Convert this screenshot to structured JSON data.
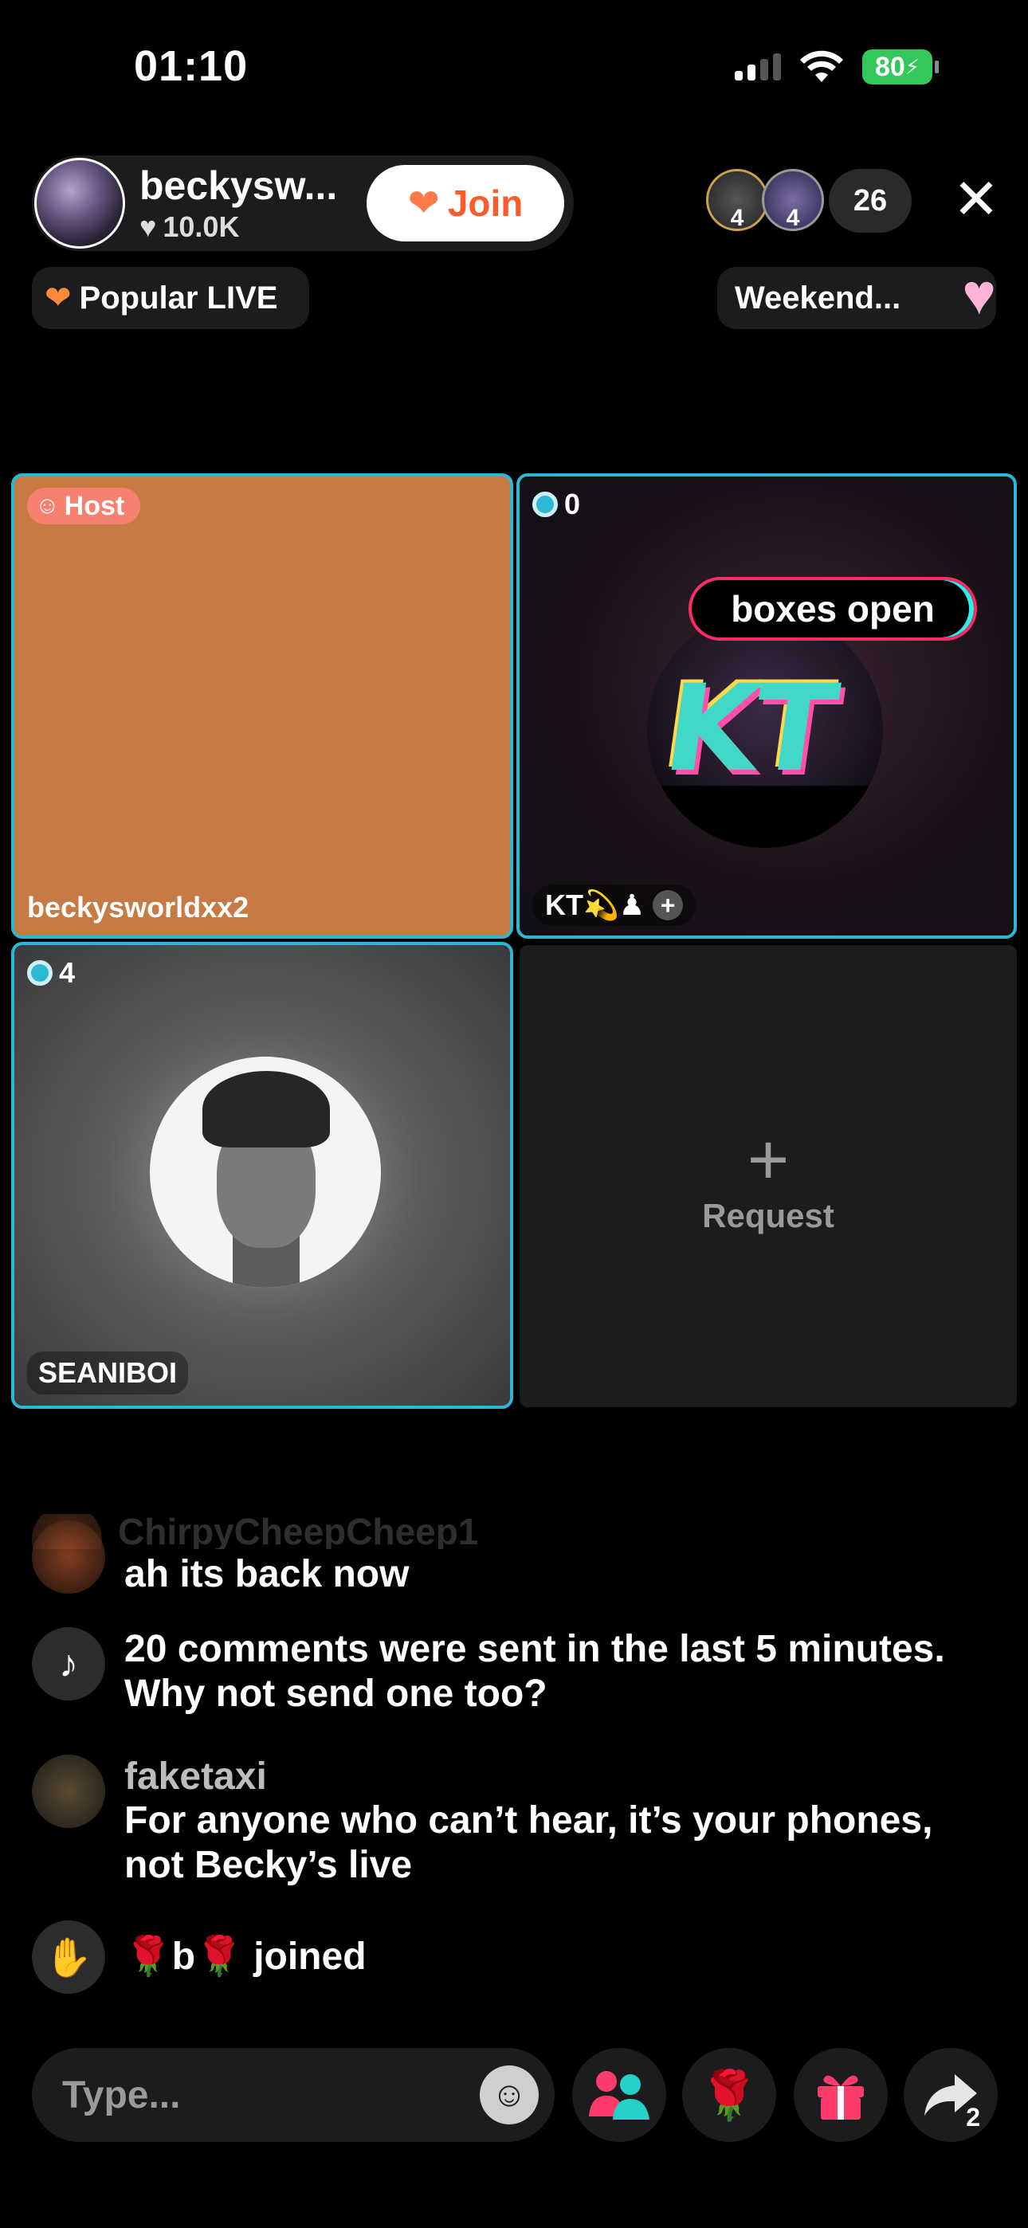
{
  "status_bar": {
    "time": "01:10",
    "battery": "80"
  },
  "header": {
    "host_name": "beckysw...",
    "host_likes": "10.0K",
    "join_label": "Join",
    "viewer_badges": [
      "4",
      "4"
    ],
    "viewer_count": "26",
    "popular_label": "Popular LIVE",
    "weekend_label": "Weekend..."
  },
  "grid": {
    "host_tile": {
      "badge": "Host",
      "name": "beckysworldxx2",
      "color": "#c87a44"
    },
    "kt_tile": {
      "count": "0",
      "logo_text": "KT",
      "overlay_text": "boxes open",
      "name": "KT💫♟"
    },
    "seani_tile": {
      "count": "4",
      "name": "SEANIBOI"
    },
    "request_tile": {
      "label": "Request"
    }
  },
  "comments": {
    "faded": "ChirpyCheepCheep1",
    "items": [
      {
        "user": "",
        "text": "ah its back now",
        "icon": "avatar"
      },
      {
        "user": "",
        "text": "20 comments were sent in the last 5 minutes. Why not send one too?",
        "icon": "tiktok-icon"
      },
      {
        "user": "faketaxi",
        "text": "For anyone who can’t hear, it’s your phones, not Becky’s live",
        "icon": "avatar"
      },
      {
        "user": "",
        "text": "🌹b🌹 joined",
        "icon": "wave-icon"
      }
    ]
  },
  "bottom_bar": {
    "input_placeholder": "Type...",
    "share_count": "2"
  },
  "colors": {
    "accent_teal": "#2bb8d4",
    "join_orange": "#ff5a2a",
    "battery_green": "#34c759",
    "overlay_pink": "#ff2a68"
  }
}
